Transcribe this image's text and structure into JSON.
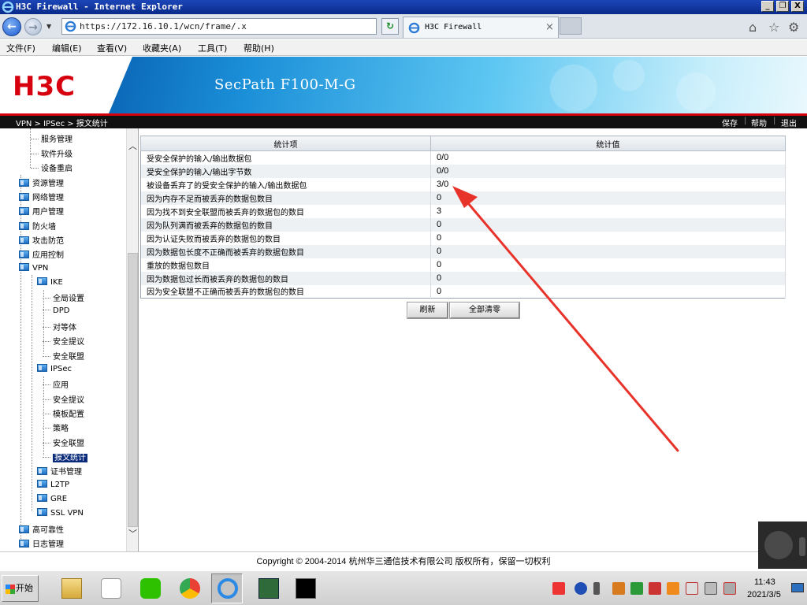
{
  "window": {
    "title": "H3C Firewall - Internet Explorer",
    "minimize": "_",
    "restore": "❐",
    "close": "X"
  },
  "browser": {
    "url": "https://172.16.10.1/wcn/frame/.x",
    "tab_title": "H3C Firewall",
    "tab_close": "×",
    "back": "←",
    "forward": "→",
    "refresh": "↻",
    "icons": [
      "home-icon",
      "star-icon",
      "gear-icon"
    ]
  },
  "menu": [
    "文件(F)",
    "编辑(E)",
    "查看(V)",
    "收藏夹(A)",
    "工具(T)",
    "帮助(H)"
  ],
  "banner": {
    "logo": "H3C",
    "product": "SecPath F100-M-G"
  },
  "crumb": {
    "path": "VPN > IPSec > 报文统计",
    "save": "保存",
    "help": "帮助",
    "logout": "退出",
    "sep": "|"
  },
  "sidebar": {
    "items": [
      {
        "label": "服务管理",
        "type": "leaf"
      },
      {
        "label": "软件升级",
        "type": "leaf"
      },
      {
        "label": "设备重启",
        "type": "leaf"
      },
      {
        "label": "资源管理",
        "type": "folder"
      },
      {
        "label": "网络管理",
        "type": "folder"
      },
      {
        "label": "用户管理",
        "type": "folder"
      },
      {
        "label": "防火墙",
        "type": "folder"
      },
      {
        "label": "攻击防范",
        "type": "folder"
      },
      {
        "label": "应用控制",
        "type": "folder"
      },
      {
        "label": "VPN",
        "type": "folder"
      },
      {
        "label": "IKE",
        "type": "folder"
      },
      {
        "label": "全局设置",
        "type": "leaf"
      },
      {
        "label": "DPD",
        "type": "leaf"
      },
      {
        "label": "对等体",
        "type": "leaf"
      },
      {
        "label": "安全提议",
        "type": "leaf"
      },
      {
        "label": "安全联盟",
        "type": "leaf"
      },
      {
        "label": "IPSec",
        "type": "folder"
      },
      {
        "label": "应用",
        "type": "leaf"
      },
      {
        "label": "安全提议",
        "type": "leaf"
      },
      {
        "label": "模板配置",
        "type": "leaf"
      },
      {
        "label": "策略",
        "type": "leaf"
      },
      {
        "label": "安全联盟",
        "type": "leaf"
      },
      {
        "label": "报文统计",
        "type": "leaf",
        "selected": true
      },
      {
        "label": "证书管理",
        "type": "folder"
      },
      {
        "label": "L2TP",
        "type": "folder"
      },
      {
        "label": "GRE",
        "type": "folder"
      },
      {
        "label": "SSL VPN",
        "type": "folder"
      },
      {
        "label": "高可靠性",
        "type": "folder"
      },
      {
        "label": "日志管理",
        "type": "folder"
      }
    ],
    "scroll_up": "︿",
    "scroll_down": "﹀"
  },
  "stats": {
    "columns": [
      "统计项",
      "统计值"
    ],
    "rows": [
      {
        "item": "受安全保护的输入/输出数据包",
        "value": "0/0"
      },
      {
        "item": "受安全保护的输入/输出字节数",
        "value": "0/0"
      },
      {
        "item": "被设备丢弃了的受安全保护的输入/输出数据包",
        "value": "3/0"
      },
      {
        "item": "因为内存不足而被丢弃的数据包数目",
        "value": "0"
      },
      {
        "item": "因为找不到安全联盟而被丢弃的数据包的数目",
        "value": "3"
      },
      {
        "item": "因为队列满而被丢弃的数据包的数目",
        "value": "0"
      },
      {
        "item": "因为认证失败而被丢弃的数据包的数目",
        "value": "0"
      },
      {
        "item": "因为数据包长度不正确而被丢弃的数据包数目",
        "value": "0"
      },
      {
        "item": "重放的数据包数目",
        "value": "0"
      },
      {
        "item": "因为数据包过长而被丢弃的数据包的数目",
        "value": "0"
      },
      {
        "item": "因为安全联盟不正确而被丢弃的数据包的数目",
        "value": "0"
      }
    ],
    "refresh_label": "刷新",
    "clear_label": "全部清零"
  },
  "footer": {
    "copyright": "Copyright © 2004-2014 杭州华三通信技术有限公司 版权所有，保留一切权利"
  },
  "taskbar": {
    "start_label": "开始",
    "apps": [
      "file-explorer-icon",
      "java-icon",
      "wechat-icon",
      "chrome-icon",
      "ie-icon",
      "terminal-app-icon",
      "cmd-icon"
    ],
    "tray_icons": [
      "sogou-icon",
      "help-icon",
      "flag-icon",
      "tray-app-1-icon",
      "tray-app-2-icon",
      "tray-app-3-icon",
      "tray-app-4-icon",
      "tray-app-5-icon",
      "network-icon",
      "volume-icon"
    ],
    "time": "11:43",
    "date": "2021/3/5"
  },
  "colors": {
    "brand_red": "#d7000f",
    "annotation_arrow": "#e8332a",
    "title_bar": "#1c46b8",
    "selected_nav": "#0a2a7a"
  }
}
